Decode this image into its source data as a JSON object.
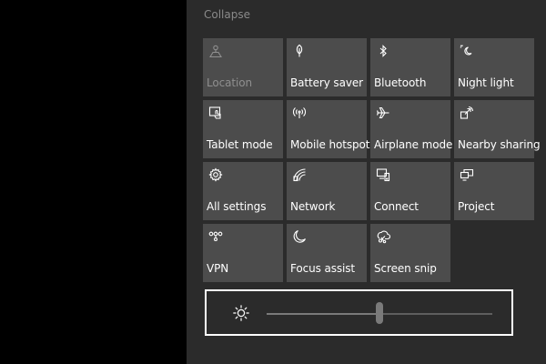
{
  "collapse_label": "Collapse",
  "tiles": [
    {
      "id": "location",
      "label": "Location",
      "icon": "location-icon",
      "enabled": false
    },
    {
      "id": "battery-saver",
      "label": "Battery saver",
      "icon": "battery-saver-icon",
      "enabled": true
    },
    {
      "id": "bluetooth",
      "label": "Bluetooth",
      "icon": "bluetooth-icon",
      "enabled": true
    },
    {
      "id": "night-light",
      "label": "Night light",
      "icon": "night-light-icon",
      "enabled": true
    },
    {
      "id": "tablet-mode",
      "label": "Tablet mode",
      "icon": "tablet-mode-icon",
      "enabled": true
    },
    {
      "id": "mobile-hotspot",
      "label": "Mobile hotspot",
      "icon": "hotspot-icon",
      "enabled": true
    },
    {
      "id": "airplane-mode",
      "label": "Airplane mode",
      "icon": "airplane-icon",
      "enabled": true
    },
    {
      "id": "nearby-sharing",
      "label": "Nearby sharing",
      "icon": "nearby-sharing-icon",
      "enabled": true
    },
    {
      "id": "all-settings",
      "label": "All settings",
      "icon": "gear-icon",
      "enabled": true
    },
    {
      "id": "network",
      "label": "Network",
      "icon": "network-icon",
      "enabled": true
    },
    {
      "id": "connect",
      "label": "Connect",
      "icon": "connect-icon",
      "enabled": true
    },
    {
      "id": "project",
      "label": "Project",
      "icon": "project-icon",
      "enabled": true
    },
    {
      "id": "vpn",
      "label": "VPN",
      "icon": "vpn-icon",
      "enabled": true
    },
    {
      "id": "focus-assist",
      "label": "Focus assist",
      "icon": "moon-icon",
      "enabled": true
    },
    {
      "id": "screen-snip",
      "label": "Screen snip",
      "icon": "screen-snip-icon",
      "enabled": true
    }
  ],
  "brightness": {
    "icon": "brightness-icon",
    "level": 0.5
  },
  "colors": {
    "panel_bg": "#2b2b2b",
    "tile_bg": "#4c4c4c",
    "tile_text": "#ffffff",
    "tile_disabled_text": "#8f8f8f",
    "collapse_text": "#8a8a8a",
    "focus_border": "#ffffff"
  }
}
